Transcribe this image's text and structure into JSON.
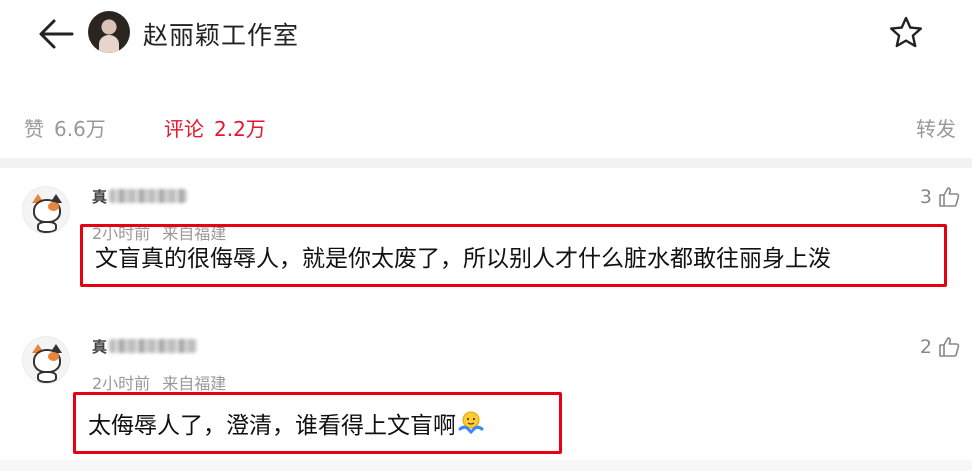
{
  "header": {
    "title": "赵丽颖工作室"
  },
  "stats": {
    "like_label": "赞",
    "like_count": "6.6万",
    "comment_label": "评论",
    "comment_count": "2.2万",
    "repost_label": "转发"
  },
  "comments": [
    {
      "username_first_char": "真",
      "time": "2小时前",
      "source": "来自福建",
      "like_count": "3",
      "text": "文盲真的很侮辱人，就是你太废了，所以别人才什么脏水都敢往丽身上泼"
    },
    {
      "username_first_char": "真",
      "time": "2小时前",
      "source": "来自福建",
      "like_count": "2",
      "text": "太侮辱人了，澄清，谁看得上文盲啊"
    }
  ],
  "colors": {
    "accent_red": "#e6162d",
    "highlight_border": "#e60012",
    "muted_text": "#999999"
  },
  "icons": {
    "back": "arrow-left-icon",
    "favorite": "star-outline-icon",
    "like": "thumbs-up-icon",
    "emoji": "shrug-emoji-icon"
  }
}
